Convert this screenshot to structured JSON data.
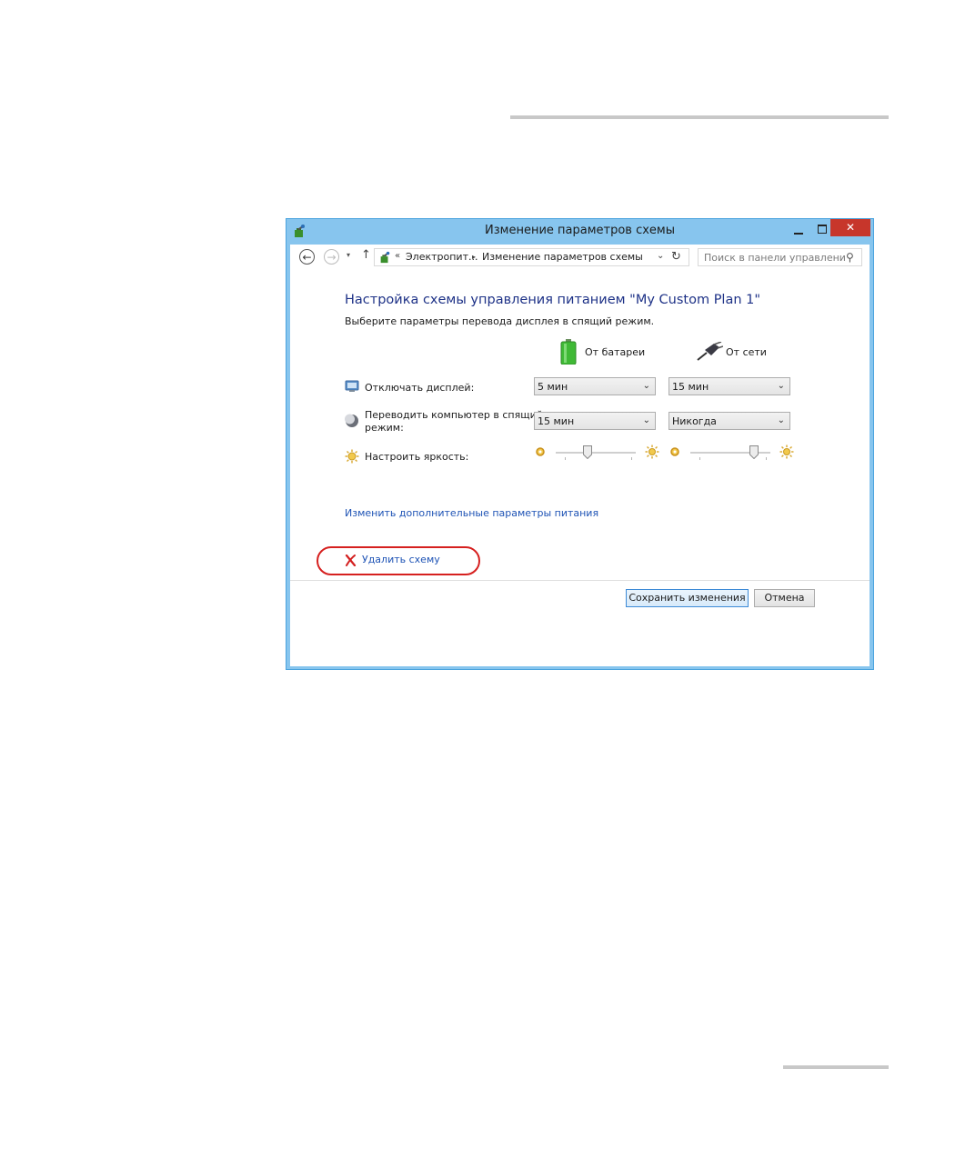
{
  "window": {
    "title": "Изменение параметров схемы",
    "close_glyph": "✕"
  },
  "nav": {
    "back_glyph": "←",
    "forward_glyph": "→",
    "recent_glyph": "▾",
    "up_glyph": "↑",
    "breadcrumb_chevron": "«",
    "breadcrumb_separator": "▸",
    "breadcrumbs": [
      "Электропит...",
      "Изменение параметров схемы"
    ],
    "dropdown_glyph": "⌄",
    "refresh_glyph": "↻",
    "search_placeholder": "Поиск в панели управления",
    "search_glyph": "⚲"
  },
  "plan": {
    "heading": "Настройка схемы управления питанием \"My Custom Plan 1\"",
    "subheading": "Выберите параметры перевода дисплея в спящий режим.",
    "columns": {
      "battery": "От батареи",
      "plugged": "От сети"
    },
    "rows": {
      "display_off": {
        "label": "Отключать дисплей:",
        "battery_value": "5 мин",
        "plugged_value": "15 мин"
      },
      "sleep": {
        "label_line1": "Переводить компьютер в спящий",
        "label_line2": "режим:",
        "battery_value": "15 мин",
        "plugged_value": "Никогда"
      },
      "brightness": {
        "label": "Настроить яркость:",
        "battery_level": 0.4,
        "plugged_level": 0.8
      }
    },
    "select_arrow": "⌄"
  },
  "links": {
    "advanced": "Изменить дополнительные параметры питания",
    "delete": "Удалить схему"
  },
  "buttons": {
    "save": "Сохранить изменения",
    "cancel": "Отмена"
  },
  "colors": {
    "window_border": "#87c5ee",
    "close_button": "#c7362b",
    "heading": "#1e3287",
    "link": "#1e53b5",
    "highlight": "#d6201f",
    "battery_green": "#3fb935"
  }
}
